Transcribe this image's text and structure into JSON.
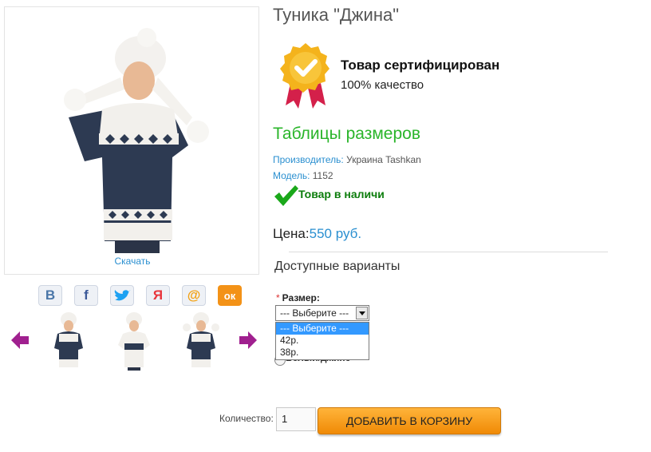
{
  "product": {
    "title": "Туника \"Джина\"",
    "download_label": "Скачать"
  },
  "badge": {
    "title": "Товар сертифицирован",
    "subtitle": "100% качество"
  },
  "sizes_link": "Таблицы размеров",
  "manufacturer": {
    "label": "Производитель:",
    "value": "Украина Tashkan"
  },
  "model": {
    "label": "Модель:",
    "value": "1152"
  },
  "stock": "Товар в наличи",
  "price": {
    "label": "Цена:",
    "value": "550 руб."
  },
  "variants_title": "Доступные варианты",
  "size_field": {
    "required_mark": "*",
    "label": "Размер:",
    "selected": "--- Выберите ---",
    "options": [
      "--- Выберите ---",
      "42р.",
      "38р."
    ]
  },
  "radio_label": "Белый/джинс",
  "quantity": {
    "label": "Количество:",
    "value": "1"
  },
  "cart_button": "ДОБАВИТЬ В КОРЗИНУ",
  "social": [
    {
      "icon": "vk-icon",
      "glyph": "B",
      "color": "#4a76a8"
    },
    {
      "icon": "facebook-icon",
      "glyph": "f",
      "color": "#3b5998"
    },
    {
      "icon": "twitter-icon",
      "glyph": "t",
      "color": "#1da1f2"
    },
    {
      "icon": "moimir-icon",
      "glyph": "Я",
      "color": "#e8343b"
    },
    {
      "icon": "mailru-icon",
      "glyph": "@",
      "color": "#f3a010"
    },
    {
      "icon": "odnoklassniki-icon",
      "glyph": "ок",
      "color": "#ffffff"
    }
  ],
  "colors": {
    "accent_green": "#2ab52a",
    "link_blue": "#2a8fd0",
    "button_orange": "#f08a06",
    "arrow_purple": "#a0208f"
  }
}
